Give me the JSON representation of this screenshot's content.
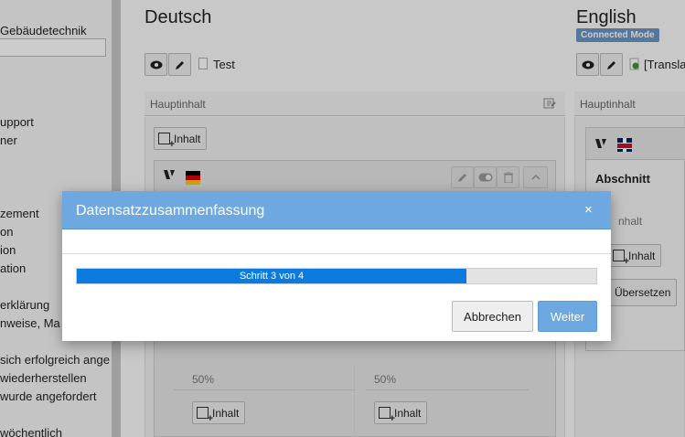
{
  "tree": {
    "items": [
      {
        "label": "Gebäudetechnik"
      },
      {
        "label": "upport"
      },
      {
        "label": "ner"
      },
      {
        "label": "zement"
      },
      {
        "label": "on"
      },
      {
        "label": "ion"
      },
      {
        "label": "ation"
      },
      {
        "label": "erklärung"
      },
      {
        "label": "nweise, Ma"
      },
      {
        "label": "sich erfolgreich ange"
      },
      {
        "label": "wiederherstellen"
      },
      {
        "label": "wurde angefordert"
      },
      {
        "label": "wöchentlich"
      }
    ]
  },
  "columns": {
    "de": {
      "title": "Deutsch",
      "page_title": "Test",
      "section": "Hauptinhalt",
      "add_content": "Inhalt",
      "grid_left_label": "50%",
      "grid_right_label": "50%"
    },
    "en": {
      "title": "English",
      "badge": "Connected Mode",
      "page_title": "[Transla",
      "section": "Hauptinhalt",
      "element_title": "Abschnitt",
      "inner_section": "nhalt",
      "add_content": "Inhalt",
      "translate_button": "Übersetzen"
    }
  },
  "modal": {
    "title": "Datensatzzusammenfassung",
    "close_symbol": "×",
    "progress": {
      "label": "Schritt 3 von 4",
      "step": 3,
      "total": 4,
      "percent": 75
    },
    "cancel_label": "Abbrechen",
    "next_label": "Weiter"
  },
  "colors": {
    "modal_header": "#6da9e0",
    "progress_fill": "#0c7be0",
    "badge": "#6b95c3"
  }
}
